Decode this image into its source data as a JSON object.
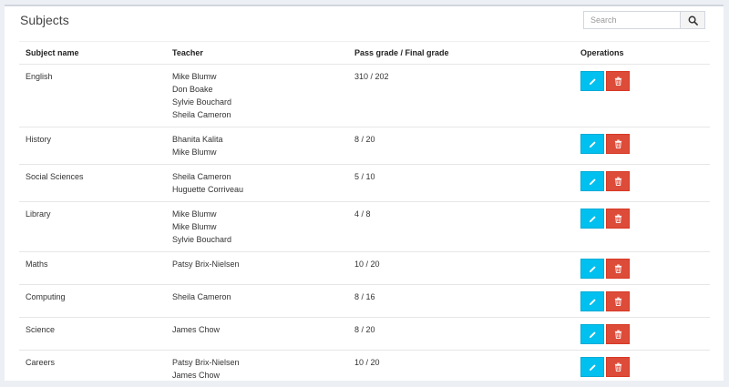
{
  "panel": {
    "title": "Subjects"
  },
  "search": {
    "placeholder": "Search",
    "icon": "search-icon"
  },
  "table": {
    "headers": [
      "Subject name",
      "Teacher",
      "Pass grade / Final grade",
      "Operations"
    ],
    "rows": [
      {
        "subject": "English",
        "teachers": [
          "Mike Blumw",
          "Don Boake",
          "Sylvie Bouchard",
          "Sheila Cameron"
        ],
        "grades": "310 / 202"
      },
      {
        "subject": "History",
        "teachers": [
          "Bhanita Kalita",
          "Mike Blumw"
        ],
        "grades": "8 / 20"
      },
      {
        "subject": "Social Sciences",
        "teachers": [
          "Sheila Cameron",
          "Huguette Corriveau"
        ],
        "grades": "5 / 10"
      },
      {
        "subject": "Library",
        "teachers": [
          "Mike Blumw",
          "Mike Blumw",
          "Sylvie Bouchard"
        ],
        "grades": "4 / 8"
      },
      {
        "subject": "Maths",
        "teachers": [
          "Patsy Brix-Nielsen"
        ],
        "grades": "10 / 20"
      },
      {
        "subject": "Computing",
        "teachers": [
          "Sheila Cameron"
        ],
        "grades": "8 / 16"
      },
      {
        "subject": "Science",
        "teachers": [
          "James Chow"
        ],
        "grades": "8 / 20"
      },
      {
        "subject": "Careers",
        "teachers": [
          "Patsy Brix-Nielsen",
          "James Chow"
        ],
        "grades": "10 / 20"
      }
    ]
  },
  "colors": {
    "edit": "#00c0ef",
    "delete": "#dd4b39",
    "background": "#ecf0f5"
  }
}
